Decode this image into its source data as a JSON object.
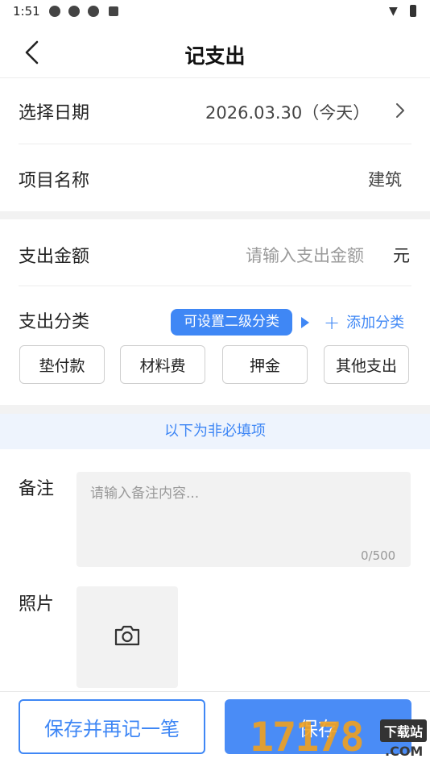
{
  "status_bar": {
    "time": "1:51",
    "battery_icon": "battery-icon",
    "wifi_icon": "wifi-icon"
  },
  "header": {
    "title": "记支出",
    "back_icon": "chevron-left-icon"
  },
  "date_row": {
    "label": "选择日期",
    "value": "2026.03.30（今天）"
  },
  "project_row": {
    "label": "项目名称",
    "value": "建筑"
  },
  "amount_row": {
    "label": "支出金额",
    "placeholder": "请输入支出金额",
    "unit": "元"
  },
  "category": {
    "label": "支出分类",
    "tooltip": "可设置二级分类",
    "add_label": "添加分类",
    "options": [
      "垫付款",
      "材料费",
      "押金",
      "其他支出"
    ]
  },
  "optional_notice": "以下为非必填项",
  "note": {
    "label": "备注",
    "placeholder": "请输入备注内容...",
    "counter": "0/500"
  },
  "photo": {
    "label": "照片",
    "icon": "camera-icon"
  },
  "footer": {
    "save_again": "保存并再记一笔",
    "save": "保存"
  },
  "watermark": {
    "brand": "17178",
    "site_tag": "下载站",
    "domain": ".COM"
  },
  "colors": {
    "accent": "#3f87f5",
    "primary_button": "#4a8cf6",
    "divider": "#ececec"
  }
}
